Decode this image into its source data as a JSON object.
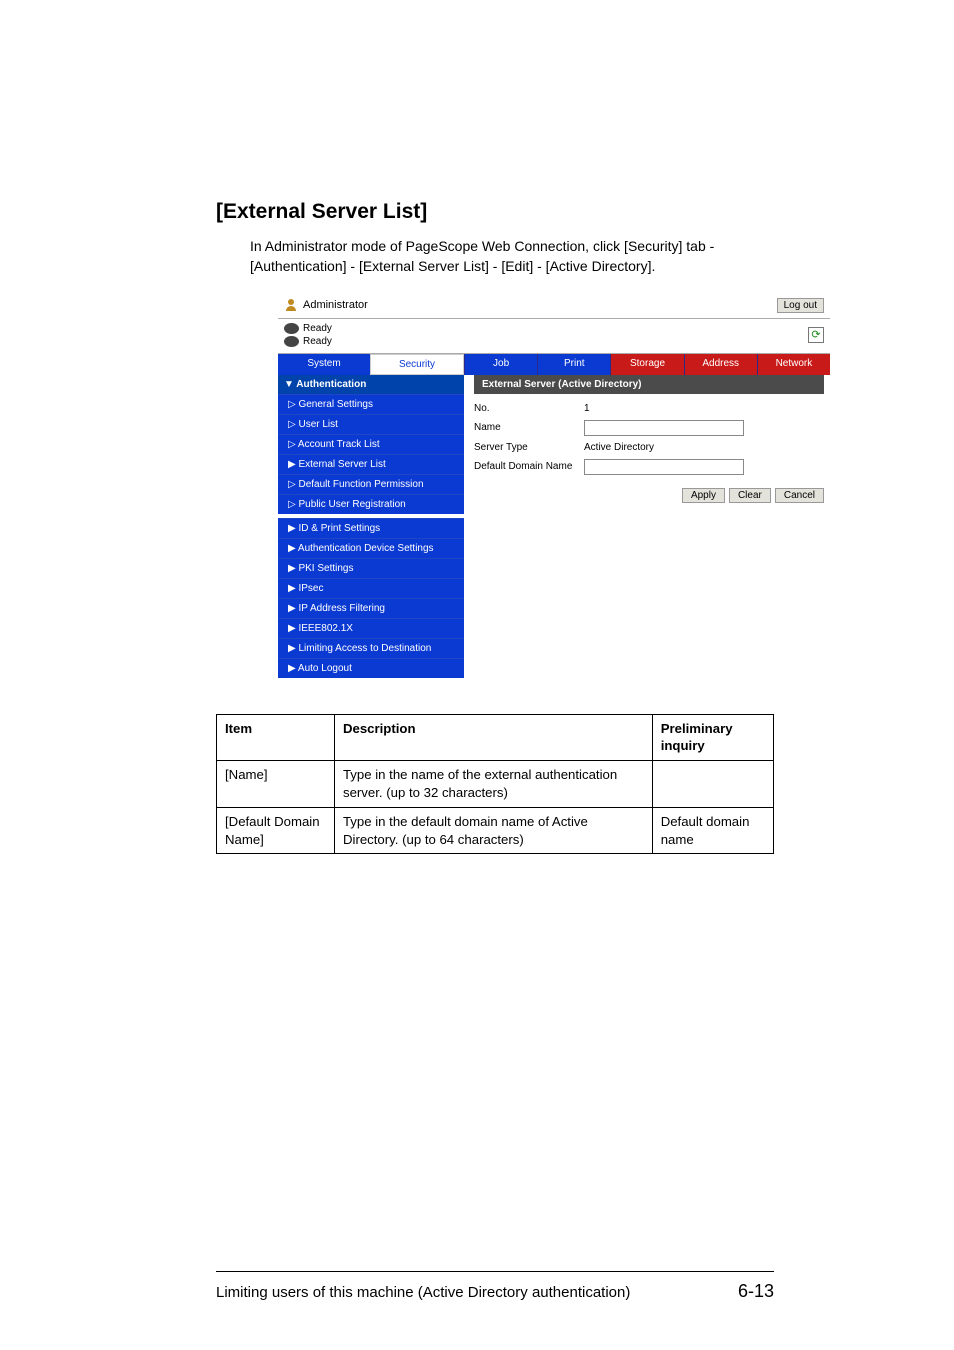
{
  "section_title": "[External Server List]",
  "intro_text": "In Administrator mode of PageScope Web Connection, click [Security] tab - [Authentication] - [External Server List] - [Edit] - [Active Directory].",
  "admin": {
    "user_label": "Administrator",
    "logout": "Log out",
    "ready1": "Ready",
    "ready2": "Ready",
    "left_tabs": {
      "system": "System",
      "security": "Security"
    },
    "main_tabs": {
      "job": "Job",
      "print": "Print",
      "storage": "Storage",
      "address": "Address",
      "network": "Network"
    },
    "side_header": "▼ Authentication",
    "side_items": [
      "▷ General Settings",
      "▷ User List",
      "▷ Account Track List",
      "▶ External Server List",
      "▷ Default Function Permission",
      "▷ Public User Registration"
    ],
    "side_items2": [
      "▶ ID & Print Settings",
      "▶ Authentication Device Settings",
      "▶ PKI Settings",
      "▶ IPsec",
      "▶ IP Address Filtering",
      "▶ IEEE802.1X",
      "▶ Limiting Access to Destination",
      "▶ Auto Logout"
    ],
    "panel_title": "External Server (Active Directory)",
    "form": {
      "no_label": "No.",
      "no_value": "1",
      "name_label": "Name",
      "server_type_label": "Server Type",
      "server_type_value": "Active Directory",
      "ddn_label": "Default Domain Name"
    },
    "buttons": {
      "apply": "Apply",
      "clear": "Clear",
      "cancel": "Cancel"
    }
  },
  "desc": {
    "headers": {
      "item": "Item",
      "description": "Description",
      "prelim": "Preliminary inquiry"
    },
    "rows": [
      {
        "item": "[Name]",
        "description": "Type in the name of the external authentication server. (up to 32 characters)",
        "prelim": ""
      },
      {
        "item": "[Default Domain Name]",
        "description": "Type in the default domain name of Active Directory. (up to 64 characters)",
        "prelim": "Default domain name"
      }
    ]
  },
  "footer": {
    "text": "Limiting users of this machine (Active Directory authentication)",
    "page": "6-13"
  }
}
